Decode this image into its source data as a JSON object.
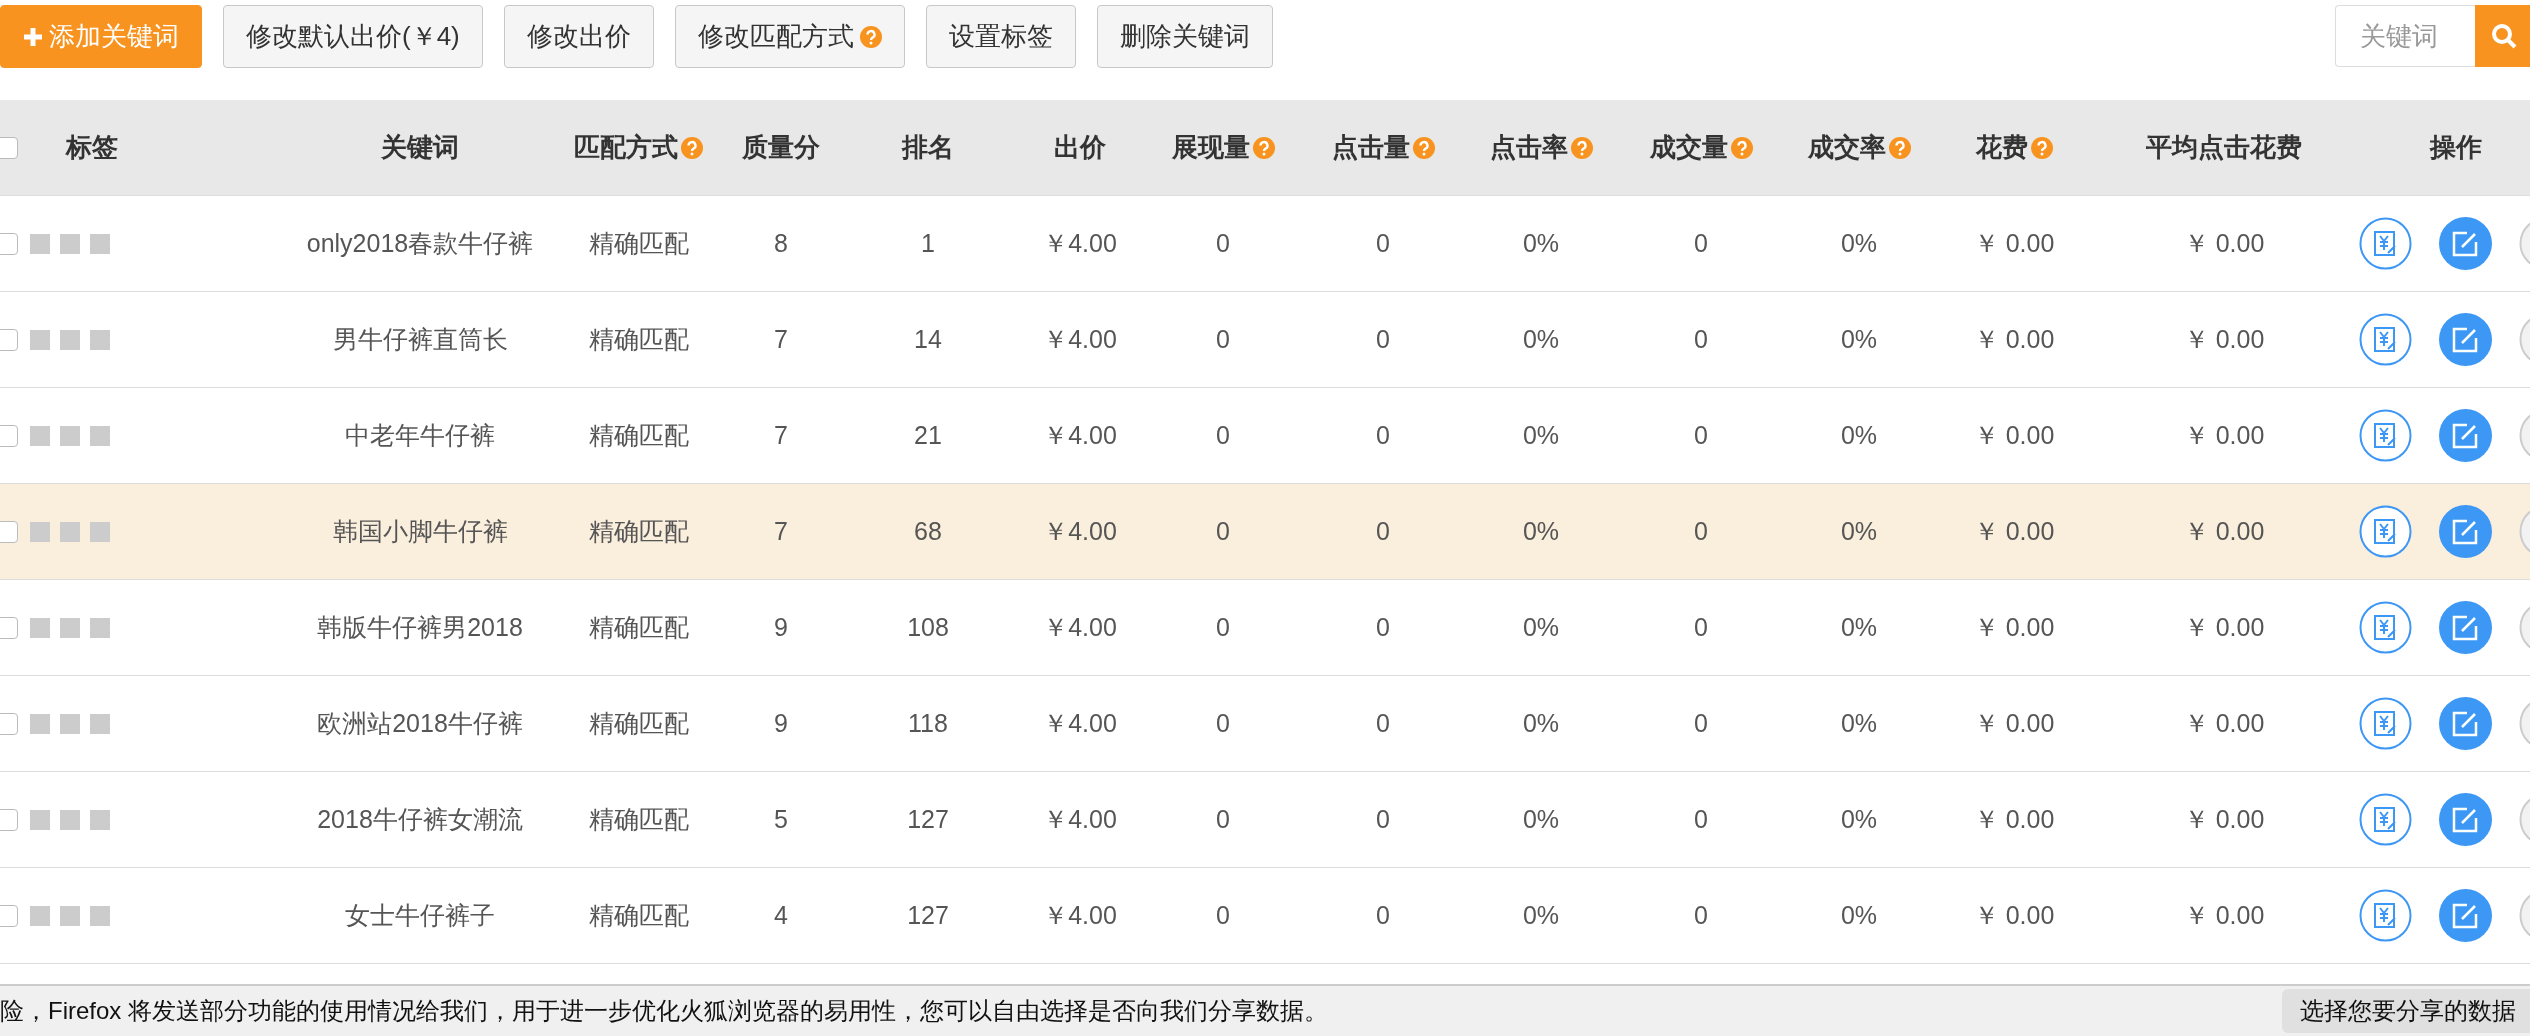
{
  "toolbar": {
    "buttons": [
      {
        "label": "添加关键词",
        "kind": "primary"
      },
      {
        "label": "修改默认出价(￥4)",
        "kind": "plain"
      },
      {
        "label": "修改出价",
        "kind": "plain"
      },
      {
        "label": "修改匹配方式",
        "kind": "help"
      },
      {
        "label": "设置标签",
        "kind": "plain"
      },
      {
        "label": "删除关键词",
        "kind": "plain"
      }
    ],
    "search": {
      "placeholder": "关键词"
    }
  },
  "table": {
    "select_all": {
      "checked": false
    },
    "columns": [
      {
        "label": "标签",
        "help": false
      },
      {
        "label": "关键词",
        "help": false
      },
      {
        "label": "匹配方式",
        "help": true
      },
      {
        "label": "质量分",
        "help": false
      },
      {
        "label": "排名",
        "help": false
      },
      {
        "label": "出价",
        "help": false
      },
      {
        "label": "展现量",
        "help": true
      },
      {
        "label": "点击量",
        "help": true
      },
      {
        "label": "点击率",
        "help": true
      },
      {
        "label": "成交量",
        "help": true
      },
      {
        "label": "成交率",
        "help": true
      },
      {
        "label": "花费",
        "help": true
      },
      {
        "label": "平均点击花费",
        "help": false
      },
      {
        "label": "操作",
        "help": false
      }
    ],
    "rows": [
      {
        "checked": false,
        "highlighted": false,
        "cells": [
          "",
          "only2018春款牛仔裤",
          "精确匹配",
          "8",
          "1",
          "￥4.00",
          "0",
          "0",
          "0%",
          "0",
          "0%",
          "￥ 0.00",
          "￥ 0.00"
        ]
      },
      {
        "checked": false,
        "highlighted": false,
        "cells": [
          "",
          "男牛仔裤直筒长",
          "精确匹配",
          "7",
          "14",
          "￥4.00",
          "0",
          "0",
          "0%",
          "0",
          "0%",
          "￥ 0.00",
          "￥ 0.00"
        ]
      },
      {
        "checked": false,
        "highlighted": false,
        "cells": [
          "",
          "中老年牛仔裤",
          "精确匹配",
          "7",
          "21",
          "￥4.00",
          "0",
          "0",
          "0%",
          "0",
          "0%",
          "￥ 0.00",
          "￥ 0.00"
        ]
      },
      {
        "checked": false,
        "highlighted": true,
        "cells": [
          "",
          "韩国小脚牛仔裤",
          "精确匹配",
          "7",
          "68",
          "￥4.00",
          "0",
          "0",
          "0%",
          "0",
          "0%",
          "￥ 0.00",
          "￥ 0.00"
        ]
      },
      {
        "checked": false,
        "highlighted": false,
        "cells": [
          "",
          "韩版牛仔裤男2018",
          "精确匹配",
          "9",
          "108",
          "￥4.00",
          "0",
          "0",
          "0%",
          "0",
          "0%",
          "￥ 0.00",
          "￥ 0.00"
        ]
      },
      {
        "checked": false,
        "highlighted": false,
        "cells": [
          "",
          "欧洲站2018牛仔裤",
          "精确匹配",
          "9",
          "118",
          "￥4.00",
          "0",
          "0",
          "0%",
          "0",
          "0%",
          "￥ 0.00",
          "￥ 0.00"
        ]
      },
      {
        "checked": false,
        "highlighted": false,
        "cells": [
          "",
          "2018牛仔裤女潮流",
          "精确匹配",
          "5",
          "127",
          "￥4.00",
          "0",
          "0",
          "0%",
          "0",
          "0%",
          "￥ 0.00",
          "￥ 0.00"
        ]
      },
      {
        "checked": false,
        "highlighted": false,
        "cells": [
          "",
          "女士牛仔裤子",
          "精确匹配",
          "4",
          "127",
          "￥4.00",
          "0",
          "0",
          "0%",
          "0",
          "0%",
          "￥ 0.00",
          "￥ 0.00"
        ]
      }
    ]
  },
  "notification_bar": {
    "message": "险，Firefox 将发送部分功能的使用情况给我们，用于进一步优化火狐浏览器的易用性，您可以自由选择是否向我们分享数据。",
    "button": "选择您要分享的数据"
  }
}
